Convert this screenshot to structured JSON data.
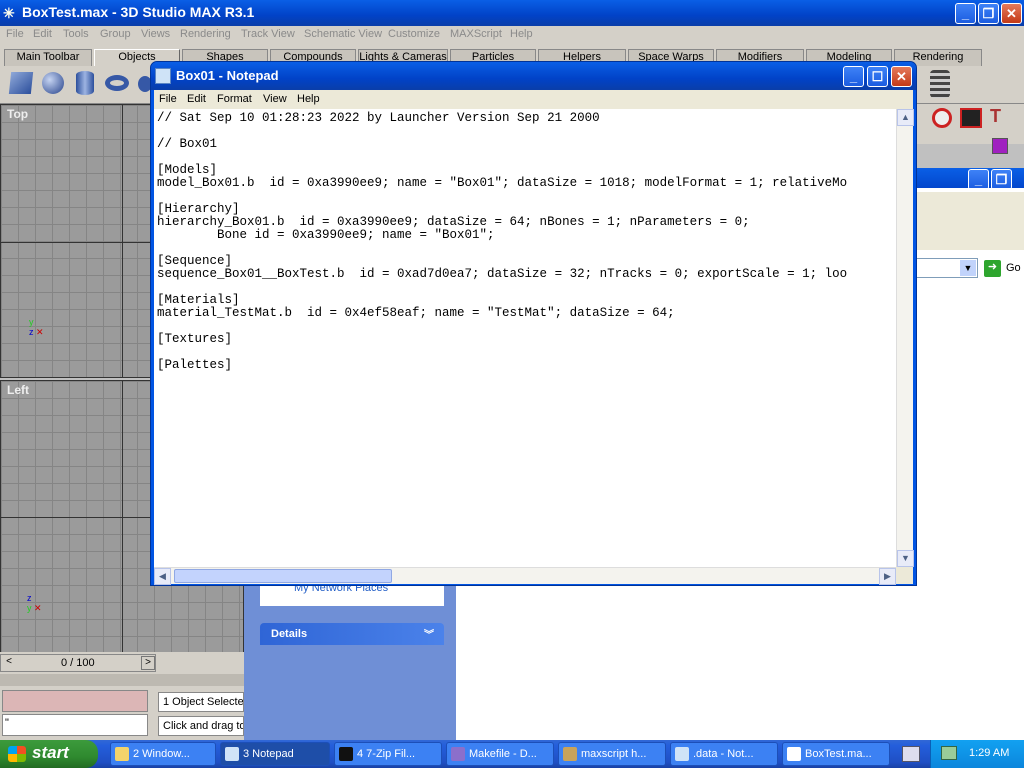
{
  "max": {
    "title": "BoxTest.max - 3D Studio MAX R3.1",
    "menu": [
      "File",
      "Edit",
      "Tools",
      "Group",
      "Views",
      "Rendering",
      "Track View",
      "Schematic View",
      "Customize",
      "MAXScript",
      "Help"
    ],
    "tabs": [
      "Main Toolbar",
      "Objects",
      "Shapes",
      "Compounds",
      "Lights & Cameras",
      "Particles",
      "Helpers",
      "Space Warps",
      "Modifiers",
      "Modeling",
      "Rendering"
    ],
    "viewport_top": "Top",
    "viewport_left": "Left",
    "time_slider": "0 / 100",
    "status_objects": "1 Object Selecte",
    "status_hint": "Click and drag to",
    "prompt_text": "\""
  },
  "explorer": {
    "network_places": "My Network Places",
    "details": "Details",
    "go_label": "Go"
  },
  "notepad": {
    "title": "Box01 - Notepad",
    "menu": [
      "File",
      "Edit",
      "Format",
      "View",
      "Help"
    ],
    "lines": [
      "// Sat Sep 10 01:28:23 2022 by Launcher Version Sep 21 2000",
      "",
      "// Box01",
      "",
      "[Models]",
      "model_Box01.b  id = 0xa3990ee9; name = \"Box01\"; dataSize = 1018; modelFormat = 1; relativeMo",
      "",
      "[Hierarchy]",
      "hierarchy_Box01.b  id = 0xa3990ee9; dataSize = 64; nBones = 1; nParameters = 0;",
      "        Bone id = 0xa3990ee9; name = \"Box01\";",
      "",
      "[Sequence]",
      "sequence_Box01__BoxTest.b  id = 0xad7d0ea7; dataSize = 32; nTracks = 0; exportScale = 1; loo",
      "",
      "[Materials]",
      "material_TestMat.b  id = 0x4ef58eaf; name = \"TestMat\"; dataSize = 64;",
      "",
      "[Textures]",
      "",
      "[Palettes]"
    ]
  },
  "taskbar": {
    "start": "start",
    "items": [
      "2 Window...",
      "3 Notepad",
      "4 7-Zip Fil...",
      "Makefile - D...",
      "maxscript h...",
      ".data - Not...",
      "BoxTest.ma..."
    ],
    "clock": "1:29 AM"
  }
}
